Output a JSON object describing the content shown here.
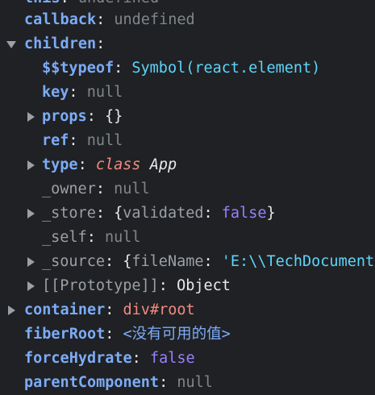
{
  "rows": {
    "this_partial": {
      "key": "this",
      "colon": ":",
      "value": "undefined"
    },
    "callback": {
      "key": "callback",
      "colon": ":",
      "value": "undefined"
    },
    "children": {
      "key": "children",
      "colon": ":"
    },
    "typeof": {
      "key": "$$typeof",
      "colon": ":",
      "value": "Symbol(react.element)"
    },
    "key": {
      "key": "key",
      "colon": ":",
      "value": "null"
    },
    "props": {
      "key": "props",
      "colon": ":",
      "value": "{}"
    },
    "ref": {
      "key": "ref",
      "colon": ":",
      "value": "null"
    },
    "type": {
      "key": "type",
      "colon": ":",
      "value_kw": "class",
      "value_name": "App"
    },
    "owner": {
      "key": "_owner",
      "colon": ":",
      "value": "null"
    },
    "store": {
      "key": "_store",
      "colon": ":",
      "open": "{",
      "inner_key": "validated",
      "inner_colon": ":",
      "inner_value": "false",
      "close": "}"
    },
    "self": {
      "key": "_self",
      "colon": ":",
      "value": "null"
    },
    "source": {
      "key": "_source",
      "colon": ":",
      "open": "{",
      "inner_key": "fileName",
      "inner_colon": ":",
      "inner_value": "'E:\\\\TechDocument"
    },
    "prototype": {
      "key": "[[Prototype]]",
      "colon": ":",
      "value": "Object"
    },
    "container": {
      "key": "container",
      "colon": ":",
      "value_tag": "div",
      "value_id": "#root"
    },
    "fiberRoot": {
      "key": "fiberRoot",
      "colon": ":",
      "value": "<没有可用的值>"
    },
    "forceHydrate": {
      "key": "forceHydrate",
      "colon": ":",
      "value": "false"
    },
    "parentComponent": {
      "key": "parentComponent",
      "colon": ":",
      "value": "null"
    }
  },
  "colors": {
    "background": "#202124",
    "key": "#7cacf8",
    "string": "#5cd5fb",
    "keyword": "#f28b82",
    "boolean": "#9980ff",
    "null": "#80868b"
  },
  "icons": {
    "expanded": "triangle-down-icon",
    "collapsed": "triangle-right-icon"
  }
}
